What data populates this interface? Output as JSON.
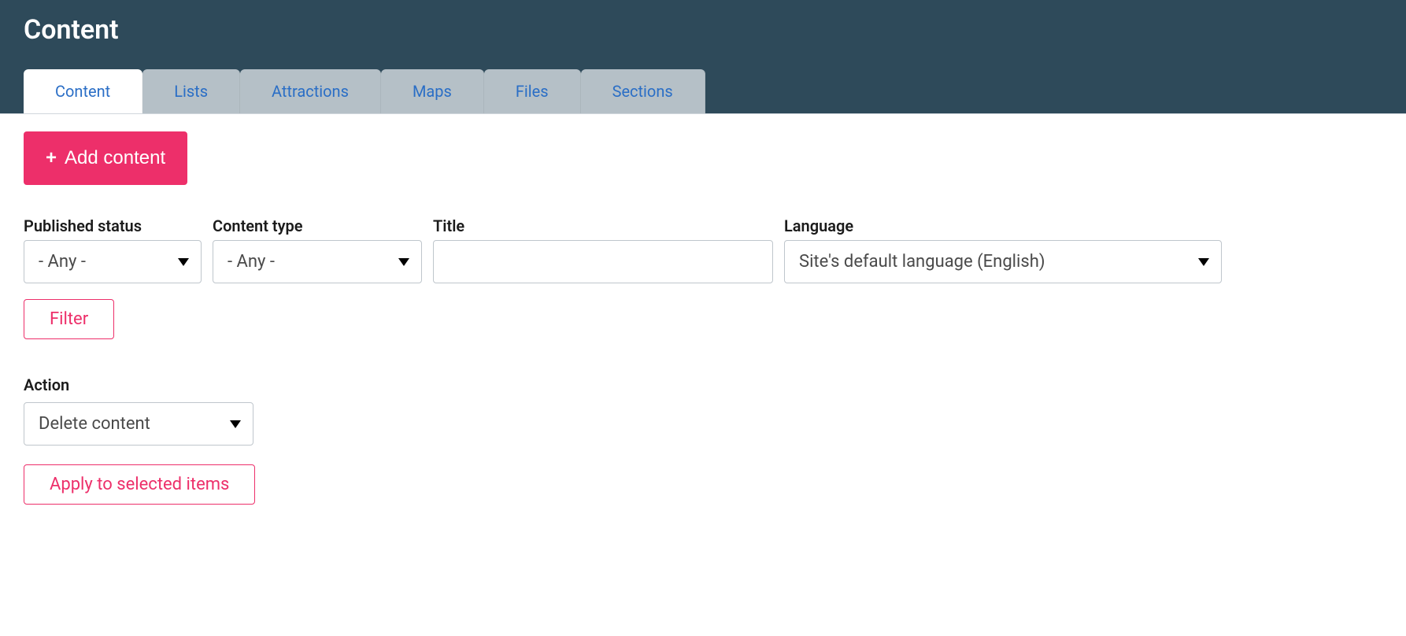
{
  "page": {
    "title": "Content"
  },
  "tabs": [
    {
      "label": "Content",
      "active": true
    },
    {
      "label": "Lists",
      "active": false
    },
    {
      "label": "Attractions",
      "active": false
    },
    {
      "label": "Maps",
      "active": false
    },
    {
      "label": "Files",
      "active": false
    },
    {
      "label": "Sections",
      "active": false
    }
  ],
  "add_button": {
    "label": "Add content"
  },
  "filters": {
    "status": {
      "label": "Published status",
      "value": "- Any -"
    },
    "type": {
      "label": "Content type",
      "value": "- Any -"
    },
    "title": {
      "label": "Title",
      "value": ""
    },
    "language": {
      "label": "Language",
      "value": "Site's default language (English)"
    },
    "filter_button": "Filter"
  },
  "bulk": {
    "label": "Action",
    "value": "Delete content",
    "apply_button": "Apply to selected items"
  }
}
